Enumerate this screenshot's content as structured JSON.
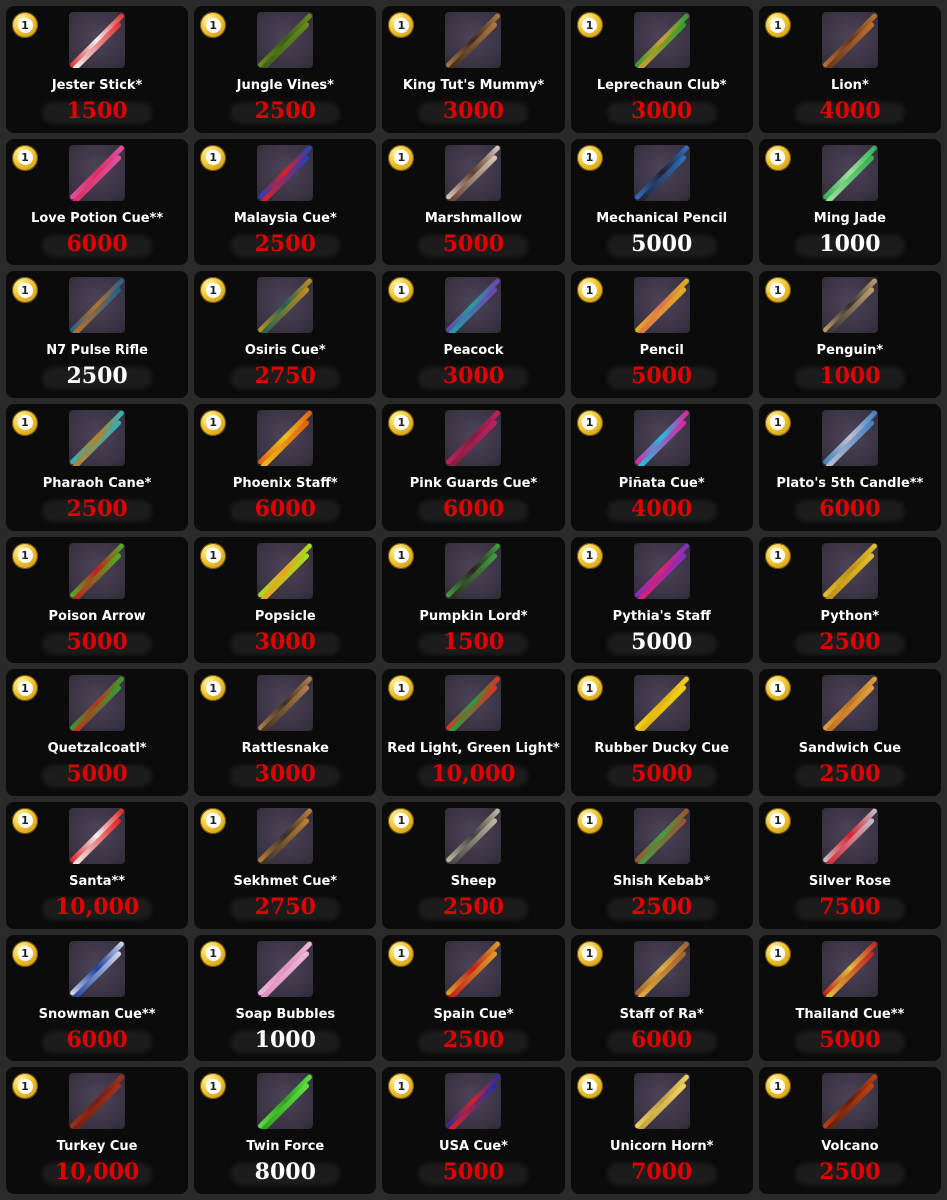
{
  "items": [
    {
      "name": "Jester Stick*",
      "price": "1500",
      "price_color": "red",
      "colors": [
        "#e03030",
        "#f0f0f0"
      ]
    },
    {
      "name": "Jungle Vines*",
      "price": "2500",
      "price_color": "red",
      "colors": [
        "#6a8a20",
        "#3c5d16"
      ]
    },
    {
      "name": "King Tut's Mummy*",
      "price": "3000",
      "price_color": "red",
      "colors": [
        "#b07a40",
        "#3a2a20"
      ]
    },
    {
      "name": "Leprechaun Club*",
      "price": "3000",
      "price_color": "red",
      "colors": [
        "#2e9c2e",
        "#d0a030"
      ]
    },
    {
      "name": "Lion*",
      "price": "4000",
      "price_color": "red",
      "colors": [
        "#c07030",
        "#603820"
      ]
    },
    {
      "name": "Love Potion Cue**",
      "price": "6000",
      "price_color": "red",
      "colors": [
        "#e050a0",
        "#d83060"
      ]
    },
    {
      "name": "Malaysia Cue*",
      "price": "2500",
      "price_color": "red",
      "colors": [
        "#2040c0",
        "#e02020"
      ]
    },
    {
      "name": "Marshmallow",
      "price": "5000",
      "price_color": "red",
      "colors": [
        "#d8c8b8",
        "#604030"
      ]
    },
    {
      "name": "Mechanical Pencil",
      "price": "5000",
      "price_color": "white",
      "colors": [
        "#3070c0",
        "#202030"
      ]
    },
    {
      "name": "Ming Jade",
      "price": "1000",
      "price_color": "white",
      "colors": [
        "#30b050",
        "#a0e0a0"
      ]
    },
    {
      "name": "N7 Pulse Rifle",
      "price": "2500",
      "price_color": "white",
      "colors": [
        "#206090",
        "#c07020"
      ]
    },
    {
      "name": "Osiris Cue*",
      "price": "2750",
      "price_color": "red",
      "colors": [
        "#c09020",
        "#206050"
      ]
    },
    {
      "name": "Peacock",
      "price": "3000",
      "price_color": "red",
      "colors": [
        "#7040b0",
        "#20a0a0"
      ]
    },
    {
      "name": "Pencil",
      "price": "5000",
      "price_color": "red",
      "colors": [
        "#e0b020",
        "#e07050"
      ]
    },
    {
      "name": "Penguin*",
      "price": "1000",
      "price_color": "red",
      "colors": [
        "#c0a070",
        "#303030"
      ]
    },
    {
      "name": "Pharaoh Cane*",
      "price": "2500",
      "price_color": "red",
      "colors": [
        "#30b0c0",
        "#c08020"
      ]
    },
    {
      "name": "Phoenix Staff*",
      "price": "6000",
      "price_color": "red",
      "colors": [
        "#e06010",
        "#f0c020"
      ]
    },
    {
      "name": "Pink Guards Cue*",
      "price": "6000",
      "price_color": "red",
      "colors": [
        "#c02060",
        "#802040"
      ]
    },
    {
      "name": "Piñata Cue*",
      "price": "4000",
      "price_color": "red",
      "colors": [
        "#e020a0",
        "#20c0e0"
      ]
    },
    {
      "name": "Plato's 5th Candle**",
      "price": "6000",
      "price_color": "red",
      "colors": [
        "#4080c0",
        "#c0c0d0"
      ]
    },
    {
      "name": "Poison Arrow",
      "price": "5000",
      "price_color": "red",
      "colors": [
        "#50b020",
        "#c02020"
      ]
    },
    {
      "name": "Popsicle",
      "price": "3000",
      "price_color": "red",
      "colors": [
        "#a0e020",
        "#f0a020"
      ]
    },
    {
      "name": "Pumpkin Lord*",
      "price": "1500",
      "price_color": "red",
      "colors": [
        "#40a040",
        "#302020"
      ]
    },
    {
      "name": "Pythia's Staff",
      "price": "5000",
      "price_color": "white",
      "colors": [
        "#8030c0",
        "#e02070"
      ]
    },
    {
      "name": "Python*",
      "price": "2500",
      "price_color": "red",
      "colors": [
        "#e0c030",
        "#c09010"
      ]
    },
    {
      "name": "Quetzalcoatl*",
      "price": "5000",
      "price_color": "red",
      "colors": [
        "#30a030",
        "#c03020"
      ]
    },
    {
      "name": "Rattlesnake",
      "price": "3000",
      "price_color": "red",
      "colors": [
        "#b08050",
        "#403020"
      ]
    },
    {
      "name": "Red Light, Green Light*",
      "price": "10,000",
      "price_color": "red",
      "colors": [
        "#e03020",
        "#20a040"
      ]
    },
    {
      "name": "Rubber Ducky Cue",
      "price": "5000",
      "price_color": "red",
      "colors": [
        "#f0d020",
        "#e0b010"
      ]
    },
    {
      "name": "Sandwich Cue",
      "price": "2500",
      "price_color": "red",
      "colors": [
        "#e0a040",
        "#c07020"
      ]
    },
    {
      "name": "Santa**",
      "price": "10,000",
      "price_color": "red",
      "colors": [
        "#e02020",
        "#f0f0f0"
      ]
    },
    {
      "name": "Sekhmet Cue*",
      "price": "2750",
      "price_color": "red",
      "colors": [
        "#c08030",
        "#303030"
      ]
    },
    {
      "name": "Sheep",
      "price": "2500",
      "price_color": "red",
      "colors": [
        "#c0b8a0",
        "#404040"
      ]
    },
    {
      "name": "Shish Kebab*",
      "price": "2500",
      "price_color": "red",
      "colors": [
        "#a05030",
        "#40a040"
      ]
    },
    {
      "name": "Silver Rose",
      "price": "7500",
      "price_color": "red",
      "colors": [
        "#c0c0c8",
        "#e02030"
      ]
    },
    {
      "name": "Snowman Cue**",
      "price": "6000",
      "price_color": "red",
      "colors": [
        "#d0d8e8",
        "#2040a0"
      ]
    },
    {
      "name": "Soap Bubbles",
      "price": "1000",
      "price_color": "white",
      "colors": [
        "#f0b8d8",
        "#e090c0"
      ]
    },
    {
      "name": "Spain Cue*",
      "price": "2500",
      "price_color": "red",
      "colors": [
        "#e0a020",
        "#c02020"
      ]
    },
    {
      "name": "Staff of Ra*",
      "price": "6000",
      "price_color": "red",
      "colors": [
        "#a06030",
        "#e0b040"
      ]
    },
    {
      "name": "Thailand Cue**",
      "price": "5000",
      "price_color": "red",
      "colors": [
        "#c02020",
        "#e0c040"
      ]
    },
    {
      "name": "Turkey Cue",
      "price": "10,000",
      "price_color": "red",
      "colors": [
        "#a03020",
        "#702010"
      ]
    },
    {
      "name": "Twin Force",
      "price": "8000",
      "price_color": "white",
      "colors": [
        "#60e040",
        "#30a020"
      ]
    },
    {
      "name": "USA Cue*",
      "price": "5000",
      "price_color": "red",
      "colors": [
        "#2030a0",
        "#e02020"
      ]
    },
    {
      "name": "Unicorn Horn*",
      "price": "7000",
      "price_color": "red",
      "colors": [
        "#f0d060",
        "#c0a040"
      ]
    },
    {
      "name": "Volcano",
      "price": "2500",
      "price_color": "red",
      "colors": [
        "#c04010",
        "#602010"
      ]
    }
  ],
  "badge_label": "1",
  "badge_icon": "pool-ball-1-icon",
  "colors": {
    "red_price": "#e00000",
    "white_price": "#ffffff",
    "card_bg": "#0b0b0b",
    "page_bg": "#2a2a2a"
  }
}
